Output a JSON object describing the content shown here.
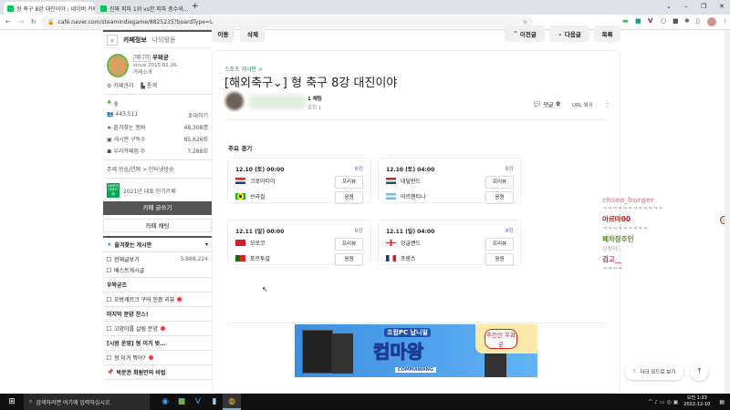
{
  "browser": {
    "tabs": [
      {
        "title": "형 축구 8강 대진이야 : 네이버 카페"
      },
      {
        "title": "진짜 피파 1위 vs한 피파 중수와..."
      }
    ],
    "new_tab": "+",
    "url": "cafe.naver.com/steamindiegame/8825235?boardType=L",
    "window_controls": [
      "⌄",
      "–",
      "❐",
      "✕"
    ]
  },
  "sidebar": {
    "tabs": [
      "카페정보",
      "나의활동"
    ],
    "manager_badge": "매니저",
    "manager": "우왁굳",
    "since": "since 2015.02.26.",
    "intro": "카페소개",
    "links": [
      "카페관리",
      "통계"
    ],
    "rank": "숲",
    "members": "443,511",
    "invite": "초대하기",
    "stats": [
      {
        "label": "즐겨찾는 멤버",
        "value": "48,308명"
      },
      {
        "label": "게시판 구독수",
        "value": "85,626회"
      },
      {
        "label": "우리카페앱 수",
        "value": "7,288회"
      }
    ],
    "topic": "주제  방송/연예 > 인터넷방송",
    "award_badge": "NAVER 대표카페",
    "award": "2021년 대표 인기카페",
    "write_button": "카페 글쓰기",
    "chat_button": "카페 채팅",
    "fav_boards": "즐겨찾는 게시판",
    "menu": [
      {
        "label": "전체글보기",
        "count": "5,888,224",
        "type": "item"
      },
      {
        "label": "베스트게시글",
        "type": "item"
      },
      {
        "label": "우왁굳즈",
        "type": "header"
      },
      {
        "label": "오방게르크 구어 인증 리뷰",
        "type": "item",
        "new": true
      },
      {
        "label": "마지막 분양 찬스!",
        "type": "header"
      },
      {
        "label": "고양이를 살림 분양",
        "type": "item",
        "new": true
      },
      {
        "label": "[시범 운영] 형 이거 벚...",
        "type": "header"
      },
      {
        "label": "형 이거 뭐야?",
        "type": "item",
        "new": true
      },
      {
        "label": "박문권 회원만의 비법",
        "type": "header"
      }
    ]
  },
  "toolbar": {
    "move": "이동",
    "delete": "삭제",
    "prev": "이전글",
    "next": "다음글",
    "list": "목록"
  },
  "article": {
    "board": "스포츠 게시판 >",
    "title": "[해외축구⌄] 형 축구 8강 대진이야",
    "author_level": "1 채팅",
    "views": "조회 1",
    "comments_label": "댓글",
    "comments_count": "0",
    "url_copy": "URL 복사",
    "section": "주요 경기"
  },
  "matches": [
    {
      "datetime": "12.10 (토) 00:00",
      "round": "8강",
      "teams": [
        "크로아티아",
        "브라질"
      ],
      "buttons": [
        "프리뷰",
        "응원"
      ]
    },
    {
      "datetime": "12.10 (토) 04:00",
      "round": "8강",
      "teams": [
        "네덜란드",
        "아르헨티나"
      ],
      "buttons": [
        "프리뷰",
        "응원"
      ]
    },
    {
      "datetime": "12.11 (일) 00:00",
      "round": "8강",
      "teams": [
        "모로코",
        "포르투갈"
      ],
      "buttons": [
        "프리뷰",
        "응원"
      ]
    },
    {
      "datetime": "12.11 (일) 04:00",
      "round": "8강",
      "teams": [
        "잉글랜드",
        "프랑스"
      ],
      "buttons": [
        "프리뷰",
        "응원"
      ]
    }
  ],
  "banner": {
    "line1": "조립PC 납니일",
    "line2": "컴마왕",
    "badge": "추천인 우왁굳",
    "brand": "COMMAWANG"
  },
  "chat": [
    {
      "user": "chsee_burger",
      "msg": "ㅋㅋㅋㅋㅋㅋㅋㅋㅋㅋㅋㅋ",
      "color": "#e0a0a0"
    },
    {
      "user": "아르마00",
      "msg": "ㅋㅋㅋㅋㅋㅋㅋㅋㅋ",
      "color": "#cc1111"
    },
    {
      "user": "페차장주인",
      "msg": "상성이...",
      "color": "#558b22"
    },
    {
      "user": "검고__",
      "msg": "ㅋㅋㅋㅋ",
      "color": "#c0306a"
    }
  ],
  "dark_mode": "다크 모드로 보기",
  "taskbar": {
    "search": "검색하려면 여기에 입력하십시오.",
    "time": "오전 1:33",
    "date": "2022-12-10"
  }
}
